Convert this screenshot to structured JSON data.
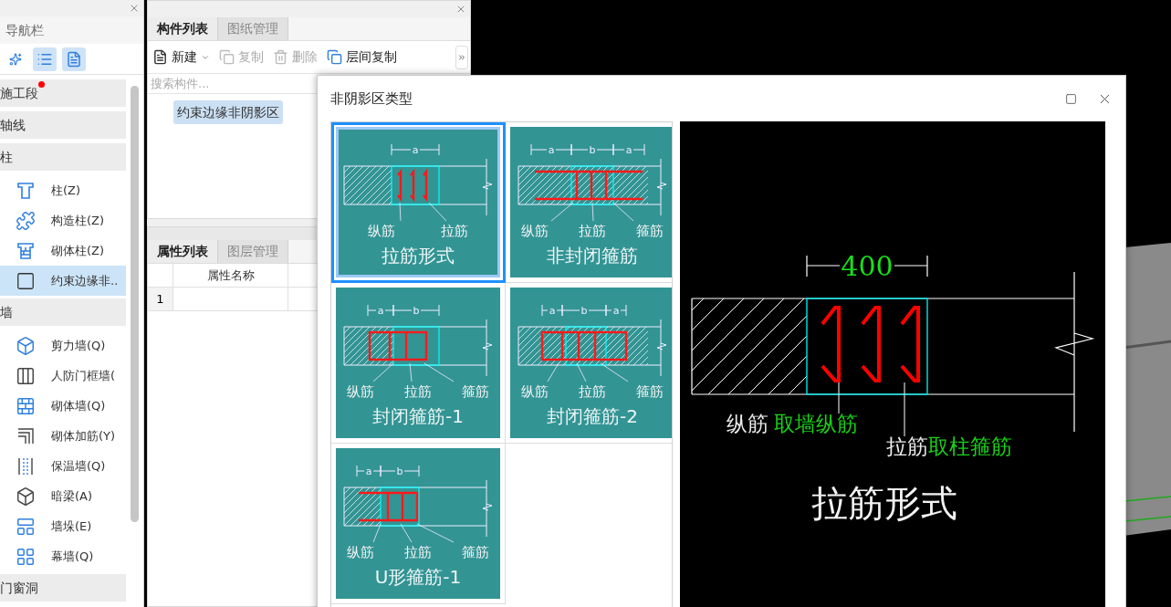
{
  "nav": {
    "title": "导航栏",
    "view_buttons": [
      {
        "selected": false
      },
      {
        "selected": true
      },
      {
        "selected": true
      }
    ],
    "groups": [
      {
        "label": "施工段",
        "alert": true
      },
      {
        "label": "轴线",
        "alert": false
      },
      {
        "label": "柱",
        "alert": false,
        "children": [
          {
            "label": "柱(Z)",
            "selected": false
          },
          {
            "label": "构造柱(Z)",
            "selected": false
          },
          {
            "label": "砌体柱(Z)",
            "selected": false
          },
          {
            "label": "约束边缘非..",
            "selected": true
          }
        ]
      },
      {
        "label": "墙",
        "alert": false,
        "children": [
          {
            "label": "剪力墙(Q)",
            "selected": false
          },
          {
            "label": "人防门框墙(",
            "selected": false
          },
          {
            "label": "砌体墙(Q)",
            "selected": false
          },
          {
            "label": "砌体加筋(Y)",
            "selected": false
          },
          {
            "label": "保温墙(Q)",
            "selected": false
          },
          {
            "label": "暗梁(A)",
            "selected": false
          },
          {
            "label": "墙垛(E)",
            "selected": false
          },
          {
            "label": "幕墙(Q)",
            "selected": false
          }
        ]
      },
      {
        "label": "门窗洞",
        "alert": false
      }
    ]
  },
  "component_panel": {
    "tabs": [
      {
        "label": "构件列表",
        "selected": true
      },
      {
        "label": "图纸管理",
        "selected": false
      }
    ],
    "toolbar": [
      {
        "kind": "new",
        "label": "新建",
        "disabled": false
      },
      {
        "kind": "copy",
        "label": "复制",
        "disabled": true
      },
      {
        "kind": "delete",
        "label": "删除",
        "disabled": true
      },
      {
        "kind": "floor_copy",
        "label": "层间复制",
        "disabled": false
      }
    ],
    "search": {
      "placeholder": "搜索构件..."
    },
    "items": [
      {
        "label": "约束边缘非阴影区",
        "selected": true
      }
    ]
  },
  "property_panel": {
    "tabs": [
      {
        "label": "属性列表",
        "selected": true
      },
      {
        "label": "图层管理",
        "selected": false
      }
    ],
    "columns": [
      "属性名称"
    ],
    "rows": [
      {
        "number": "1"
      }
    ]
  },
  "dialog": {
    "title": "非阴影区类型",
    "tiles": [
      {
        "kind": "tie",
        "title": "拉筋形式",
        "dims": [
          "a"
        ],
        "labels": [
          "纵筋",
          "拉筋"
        ],
        "selected": true
      },
      {
        "kind": "open",
        "title": "非封闭箍筋",
        "dims": [
          "a",
          "b",
          "a"
        ],
        "labels": [
          "纵筋",
          "拉筋",
          "箍筋"
        ],
        "selected": false
      },
      {
        "kind": "closed1",
        "title": "封闭箍筋-1",
        "dims": [
          "a",
          "b"
        ],
        "labels": [
          "纵筋",
          "拉筋",
          "箍筋"
        ],
        "selected": false
      },
      {
        "kind": "closed2",
        "title": "封闭箍筋-2",
        "dims": [
          "a",
          "b",
          "a"
        ],
        "labels": [
          "纵筋",
          "拉筋",
          "箍筋"
        ],
        "selected": false
      },
      {
        "kind": "u",
        "title": "U形箍筋-1",
        "dims": [
          "a",
          "b"
        ],
        "labels": [
          "纵筋",
          "拉筋",
          "箍筋"
        ],
        "selected": false
      }
    ],
    "preview": {
      "dimension": "400",
      "callouts": [
        {
          "label": "纵筋",
          "note": "取墙纵筋"
        },
        {
          "label": "拉筋",
          "note": "取柱箍筋"
        }
      ],
      "title": "拉筋形式"
    }
  }
}
